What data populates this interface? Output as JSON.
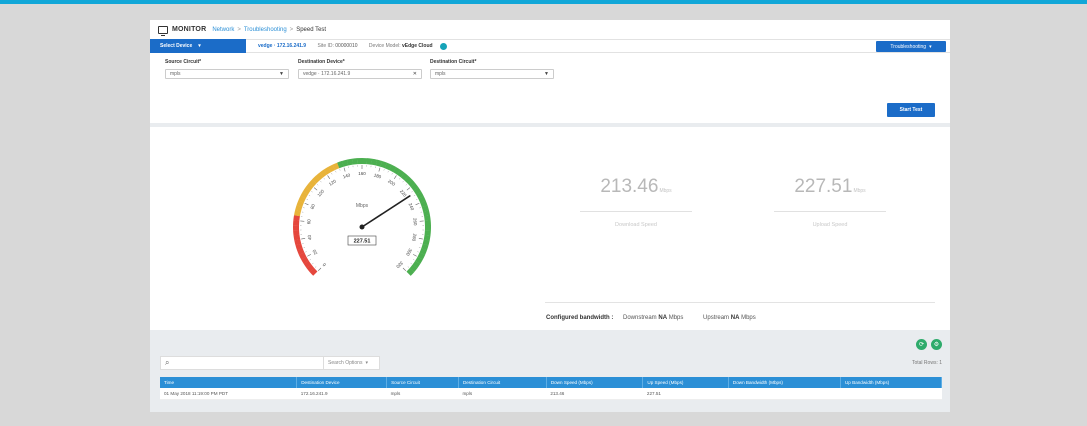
{
  "header": {
    "title": "MONITOR",
    "breadcrumbs": [
      "Network",
      "Troubleshooting",
      "Speed Test"
    ]
  },
  "device_bar": {
    "select_device": "Select Device",
    "device_name": "vedge · 172.16.241.9",
    "site_id_label": "Site ID:",
    "site_id": "00000010",
    "model_label": "Device Model:",
    "model": "vEdge Cloud",
    "troubleshooting_button": "Troubleshooting"
  },
  "form": {
    "source_circuit_label": "Source Circuit*",
    "source_circuit_value": "mpls",
    "destination_device_label": "Destination Device*",
    "destination_device_value": "vedge · 172.16.241.9",
    "destination_circuit_label": "Destination Circuit*",
    "destination_circuit_value": "mpls",
    "start_button": "Start Test"
  },
  "gauge": {
    "unit": "Mbps",
    "reading": "227.51",
    "value": 227.51,
    "max": 320,
    "ticks": [
      "0",
      "20",
      "40",
      "60",
      "80",
      "100",
      "120",
      "140",
      "160",
      "180",
      "200",
      "220",
      "240",
      "260",
      "280",
      "300",
      "320"
    ]
  },
  "results": {
    "download": {
      "value": "213.46",
      "unit": "Mbps",
      "label": "Download Speed"
    },
    "upload": {
      "value": "227.51",
      "unit": "Mbps",
      "label": "Upload Speed"
    }
  },
  "bandwidth": {
    "label": "Configured bandwidth :",
    "downstream_label": "Downstream",
    "downstream_value": "NA",
    "upstream_label": "Upstream",
    "upstream_value": "NA",
    "unit": "Mbps"
  },
  "search": {
    "placeholder": "",
    "options_label": "Search Options"
  },
  "table": {
    "total_rows": "Total Rows: 1",
    "columns": [
      "Time",
      "Destination Device",
      "Source Circuit",
      "Destination Circuit",
      "Down Speed (Mbps)",
      "Up Speed (Mbps)",
      "Down Bandwidth (Mbps)",
      "Up Bandwidth (Mbps)"
    ],
    "rows": [
      [
        "01 May 2018 11:19:00 PM PDT",
        "172.16.241.9",
        "mpls",
        "mpls",
        "213.46",
        "227.51",
        "",
        ""
      ]
    ]
  },
  "colors": {
    "accent": "#1b6cc8",
    "table_header": "#2b8fd6",
    "gauge_red": "#e5473d",
    "gauge_yellow": "#e8b33a",
    "gauge_green": "#4caf50",
    "action_green": "#2eab6b"
  }
}
